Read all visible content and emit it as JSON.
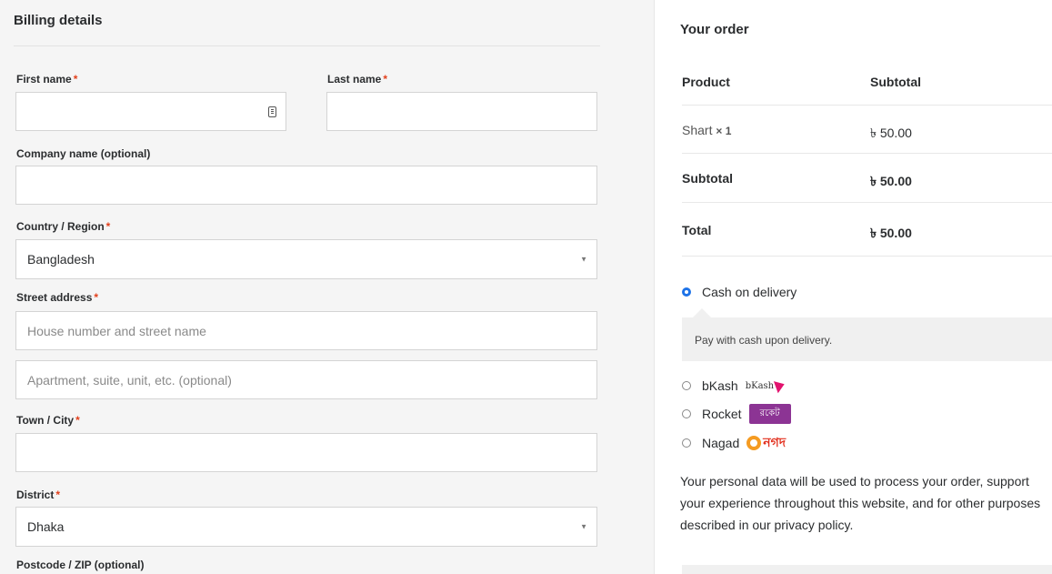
{
  "billing": {
    "title": "Billing details",
    "required_mark": "*",
    "first_name_label": "First name",
    "last_name_label": "Last name",
    "company_label": "Company name (optional)",
    "country_label": "Country / Region",
    "country_value": "Bangladesh",
    "street_label": "Street address",
    "street_placeholder": "House number and street name",
    "apartment_placeholder": "Apartment, suite, unit, etc. (optional)",
    "city_label": "Town / City",
    "district_label": "District",
    "district_value": "Dhaka",
    "postcode_label": "Postcode / ZIP (optional)"
  },
  "order": {
    "title": "Your order",
    "col_product": "Product",
    "col_subtotal": "Subtotal",
    "item_name": "Shart",
    "item_qty": "× 1",
    "item_price": "৳ 50.00",
    "subtotal_label": "Subtotal",
    "subtotal_value": "৳ 50.00",
    "total_label": "Total",
    "total_value": "৳ 50.00"
  },
  "payment": {
    "cod_label": "Cash on delivery",
    "cod_description": "Pay with cash upon delivery.",
    "bkash_label": "bKash",
    "bkash_logo_text": "bKash",
    "rocket_label": "Rocket",
    "rocket_logo_text": "রকেট",
    "nagad_label": "Nagad",
    "nagad_logo_text": "নগদ",
    "accent_color": "#1e73e8"
  },
  "privacy": {
    "text_before": "Your personal data will be used to process your order, support your experience throughout this website, and for other purposes described in our ",
    "link_text": "privacy policy",
    "text_after": "."
  },
  "icons": {
    "autofill": "contact-card-icon",
    "select_caret": "caret-down-icon"
  }
}
